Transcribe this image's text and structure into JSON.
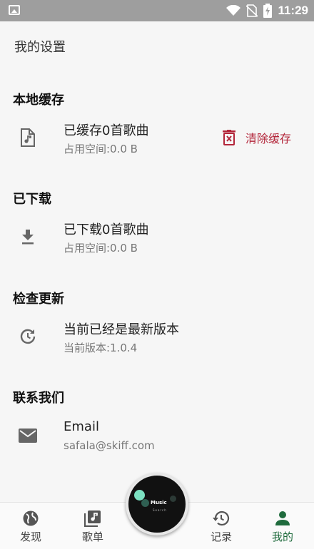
{
  "status_bar": {
    "time": "11:29"
  },
  "page_title": "我的设置",
  "sections": {
    "cache": {
      "title": "本地缓存",
      "main": "已缓存0首歌曲",
      "sub": "占用空间:0.0 B",
      "clear_label": "清除缓存",
      "accent": "#b3263a"
    },
    "download": {
      "title": "已下载",
      "main": "已下载0首歌曲",
      "sub": "占用空间:0.0 B"
    },
    "update": {
      "title": "检查更新",
      "main": "当前已经是最新版本",
      "sub": "当前版本:1.0.4"
    },
    "contact": {
      "title": "联系我们",
      "main": "Email",
      "sub": "safala@skiff.com"
    }
  },
  "bottom_nav": {
    "items": [
      {
        "label": "发现",
        "icon": "globe-icon"
      },
      {
        "label": "歌单",
        "icon": "music-library-icon"
      },
      {
        "label": "记录",
        "icon": "history-icon"
      },
      {
        "label": "我的",
        "icon": "person-icon",
        "active": true
      }
    ],
    "fab": {
      "label": "Music",
      "sublabel": "Search"
    },
    "active_color": "#1f6b3d"
  }
}
